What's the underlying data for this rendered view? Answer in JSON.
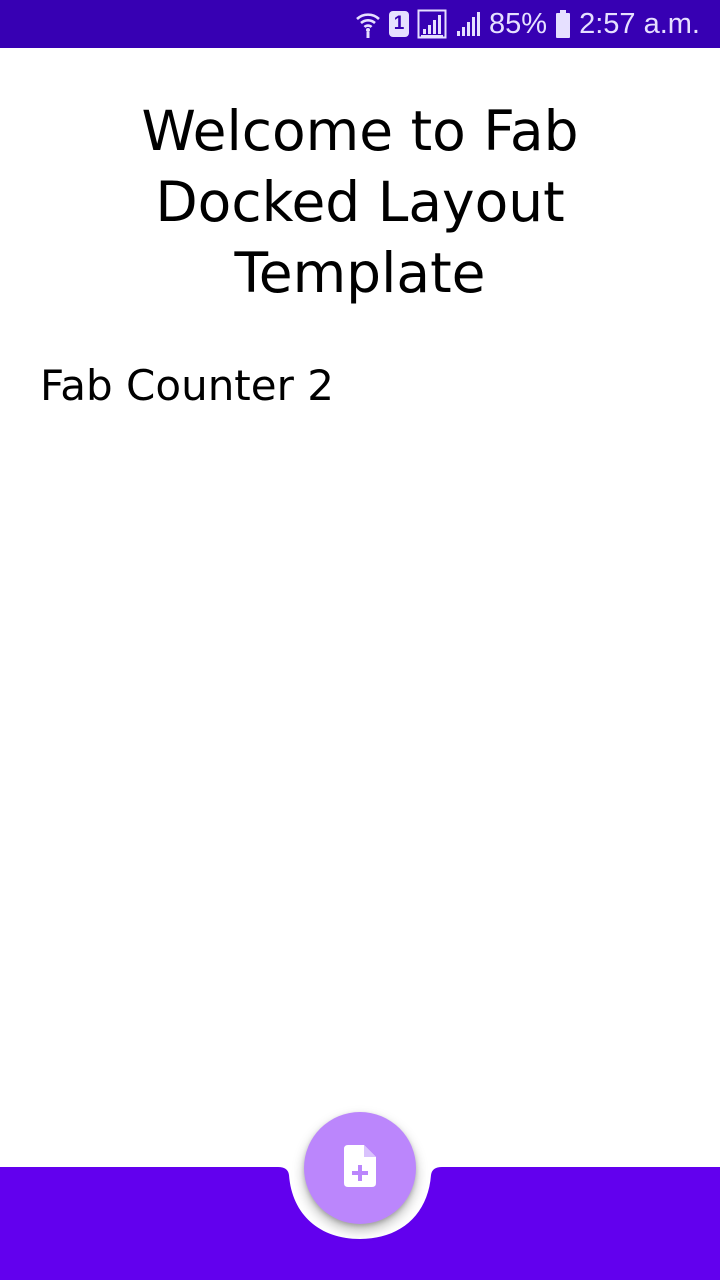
{
  "status_bar": {
    "battery": "85%",
    "time": "2:57 a.m.",
    "sim_label": "1",
    "icons": [
      "wifi-icon",
      "sim-icon",
      "signal-icon",
      "signal-icon",
      "battery-icon"
    ]
  },
  "main": {
    "title": "Welcome to Fab Docked Layout Template",
    "counter_text": "Fab Counter 2"
  },
  "fab": {
    "icon": "note-add-icon"
  },
  "colors": {
    "status_bar": "#3700b3",
    "bottom_bar": "#6200ee",
    "fab": "#bb86fc",
    "background": "#ffffff"
  }
}
